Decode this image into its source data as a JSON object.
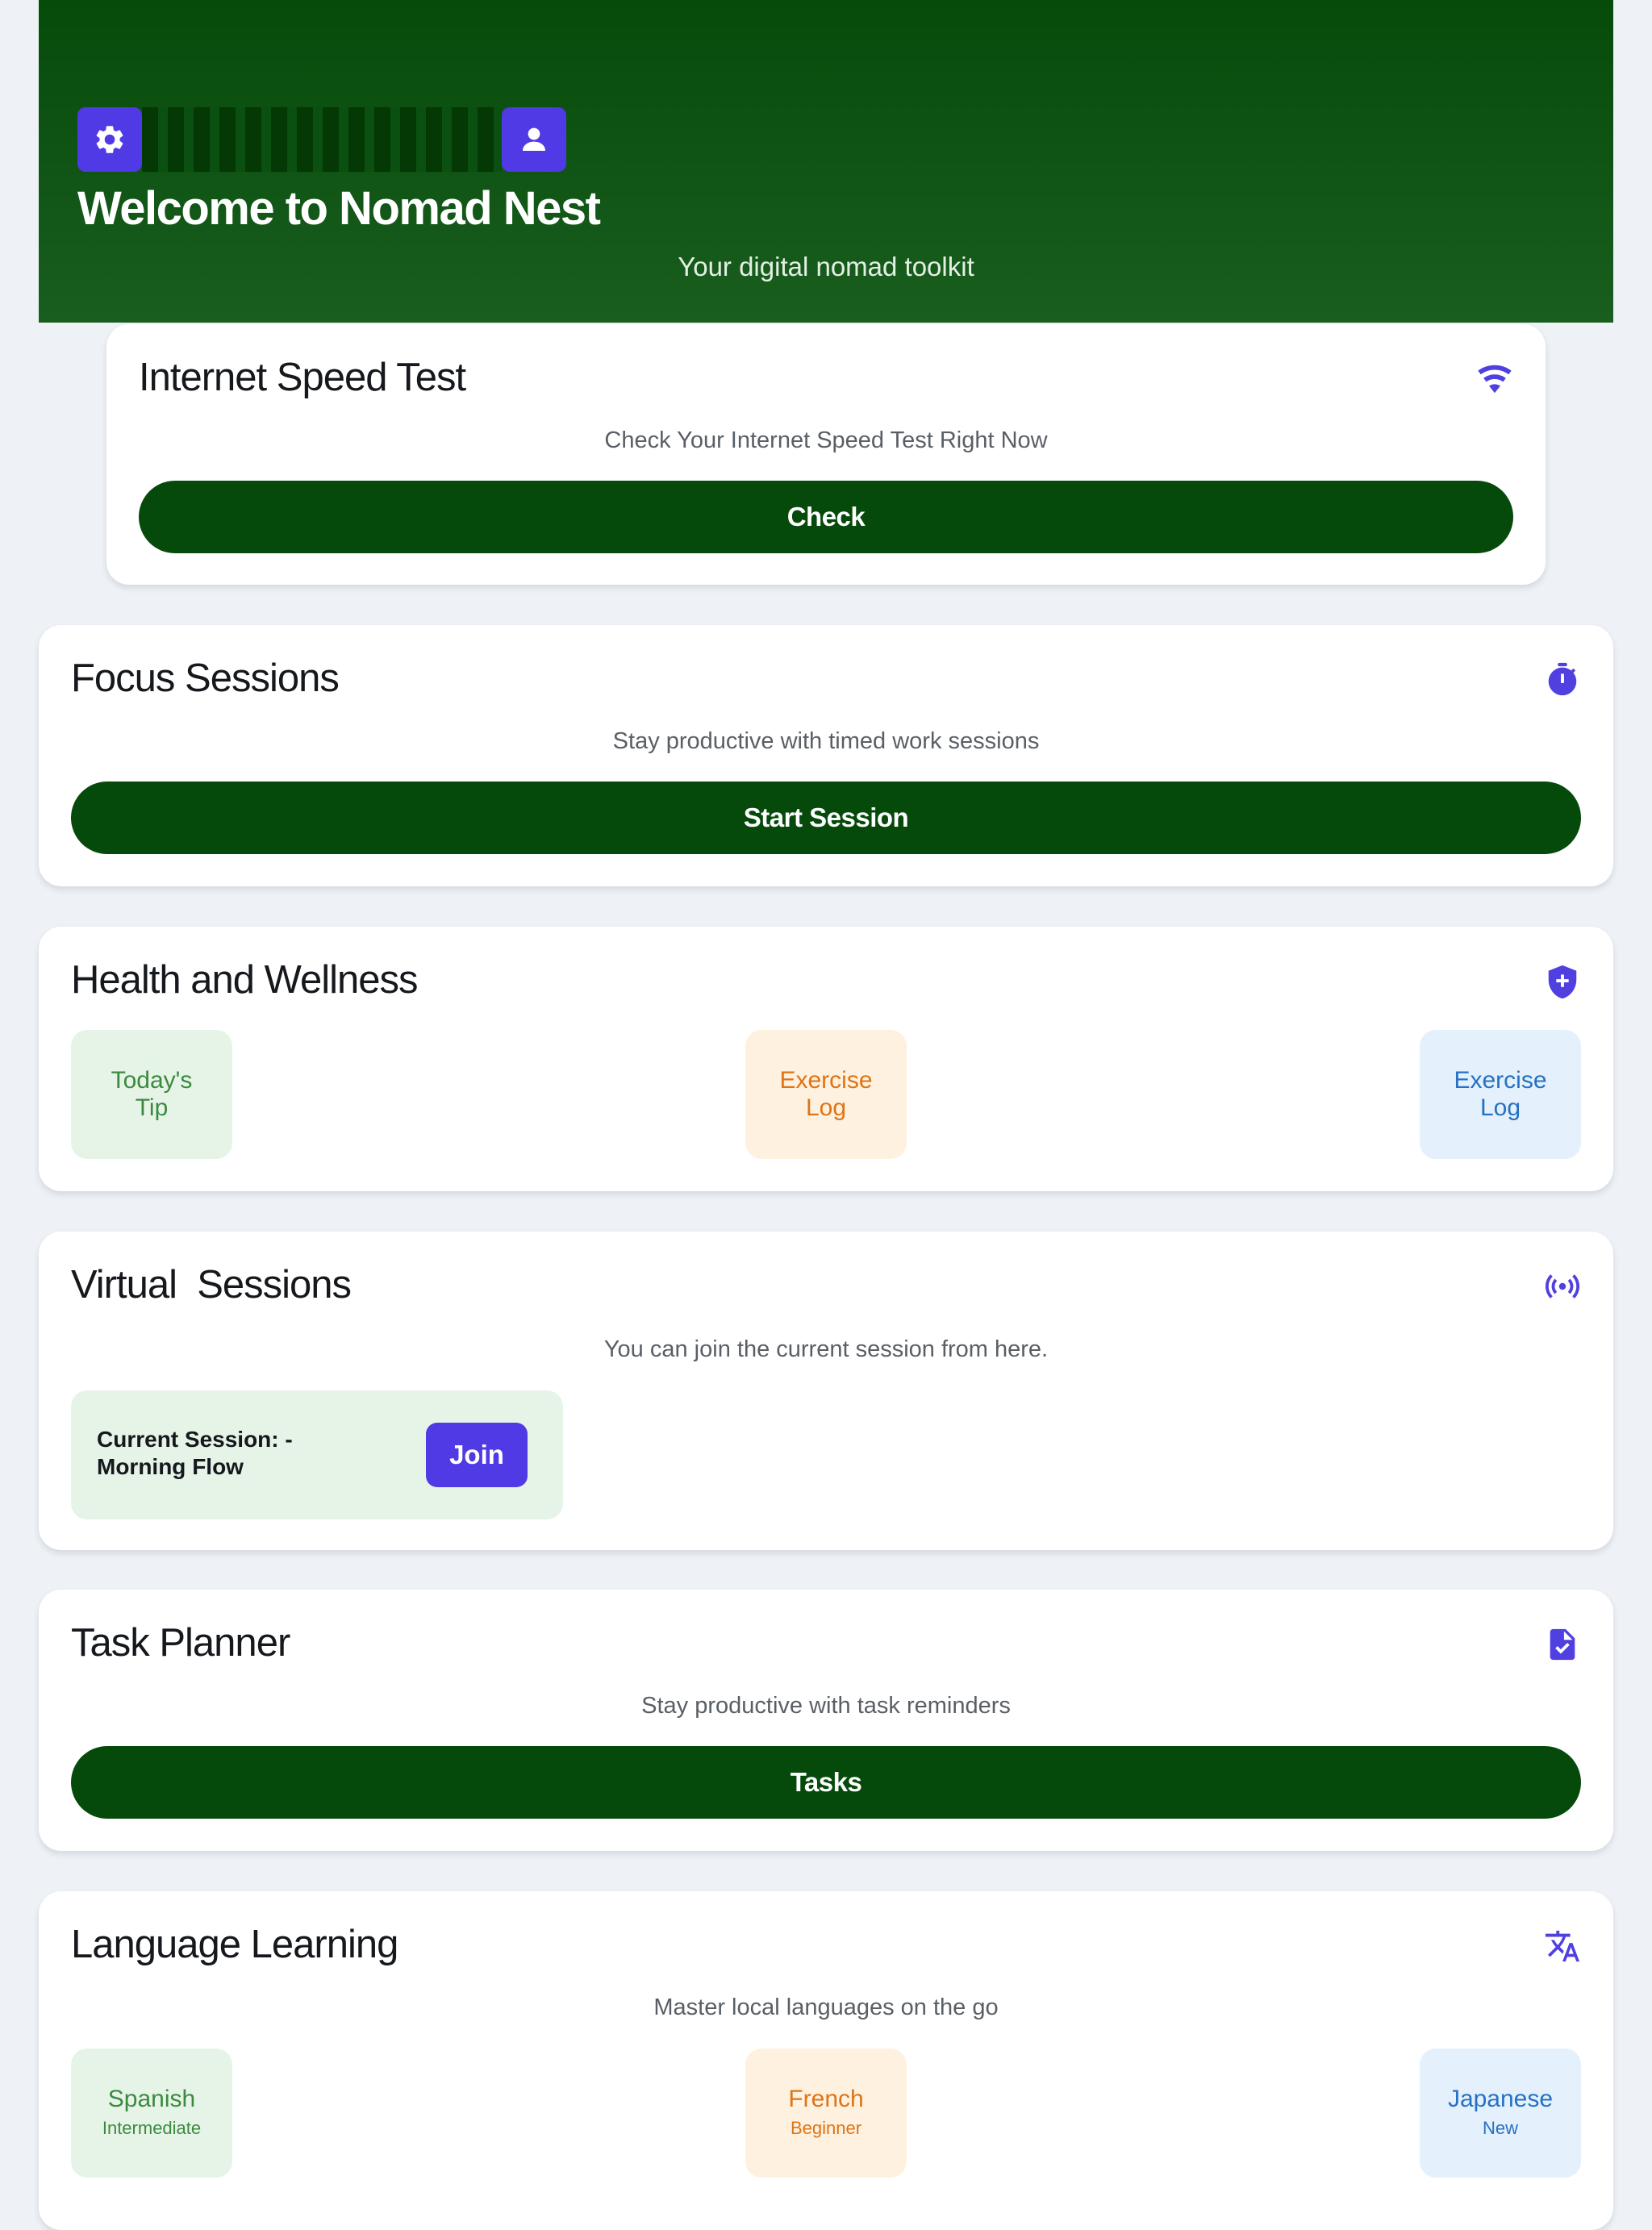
{
  "header": {
    "title": "Welcome to Nomad Nest",
    "subtitle": "Your digital nomad toolkit",
    "settings_icon": "gear-icon",
    "profile_icon": "user-icon"
  },
  "speed_test": {
    "title": "Internet Speed Test",
    "icon": "wifi-icon",
    "description": "Check Your Internet Speed Test Right Now",
    "button": "Check"
  },
  "focus": {
    "title": "Focus Sessions",
    "icon": "stopwatch-icon",
    "description": "Stay productive with timed work sessions",
    "button": "Start Session"
  },
  "health": {
    "title": "Health and Wellness",
    "icon": "shield-plus-icon",
    "tiles": [
      {
        "label": "Today's Tip"
      },
      {
        "label": "Exercise Log"
      },
      {
        "label": "Exercise Log"
      }
    ]
  },
  "virtual": {
    "title": "Virtual  Sessions",
    "icon": "broadcast-icon",
    "description": "You can join the current session from here.",
    "current_session": "Current Session: - Morning Flow",
    "join": "Join"
  },
  "tasks": {
    "title": "Task Planner",
    "icon": "file-check-icon",
    "description": "Stay productive with task reminders",
    "button": "Tasks"
  },
  "language": {
    "title": "Language Learning",
    "icon": "translate-icon",
    "description": "Master local languages on the go",
    "tiles": [
      {
        "label": "Spanish",
        "level": "Intermediate"
      },
      {
        "label": "French",
        "level": "Beginner"
      },
      {
        "label": "Japanese",
        "level": "New"
      }
    ]
  },
  "colors": {
    "header_green": "#064b0a",
    "button_green": "#054a0b",
    "accent_purple": "#4f3ae6",
    "background": "#eef2f7"
  }
}
